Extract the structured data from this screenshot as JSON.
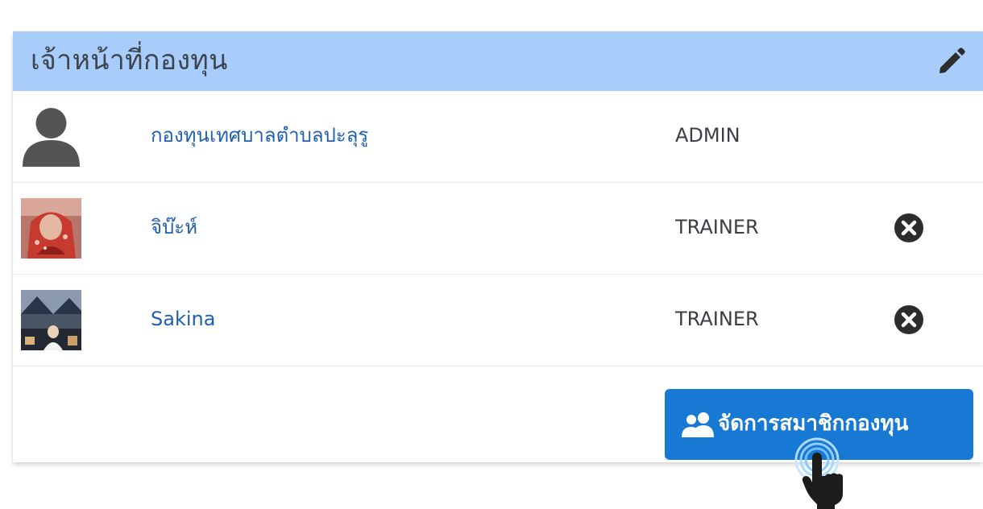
{
  "panel": {
    "title": "เจ้าหน้าที่กองทุน",
    "edit_icon": "pencil-icon"
  },
  "members": [
    {
      "name": "กองทุนเทศบาลตำบลปะลุรู",
      "role": "ADMIN",
      "avatar": "default-user-icon",
      "removable": false
    },
    {
      "name": "จิบ๊ะห์",
      "role": "TRAINER",
      "avatar": "profile-photo",
      "removable": true
    },
    {
      "name": "Sakina",
      "role": "TRAINER",
      "avatar": "profile-photo",
      "removable": true
    }
  ],
  "actions": {
    "manage_members_label": "จัดการสมาชิกกองทุน",
    "manage_members_icon": "users-icon"
  },
  "colors": {
    "header_bg": "#a9cdfa",
    "link": "#1f5fb4",
    "primary_button": "#1779d4"
  }
}
